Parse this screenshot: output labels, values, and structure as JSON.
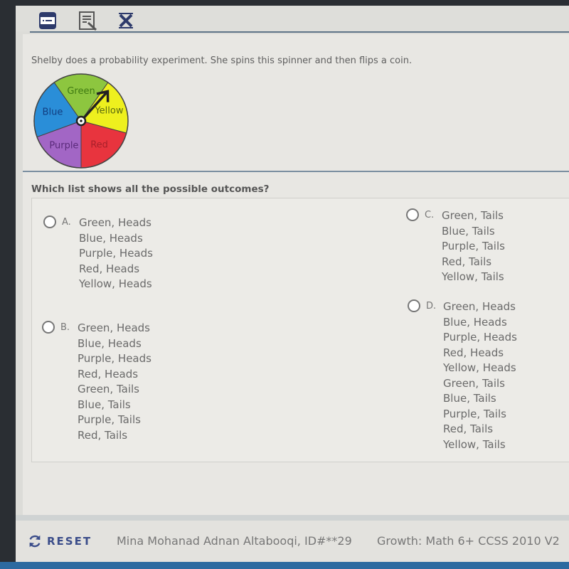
{
  "toolbar": {
    "icons": [
      "line-reader-icon",
      "notepad-icon",
      "answer-eliminator-icon"
    ]
  },
  "question": {
    "prompt": "Shelby does a probability experiment. She spins this spinner and then flips a coin.",
    "stem": "Which list shows all the possible outcomes?"
  },
  "spinner": {
    "sections": [
      {
        "label": "Green",
        "color": "#8dc63f"
      },
      {
        "label": "Yellow",
        "color": "#eef01e"
      },
      {
        "label": "Red",
        "color": "#e8343e"
      },
      {
        "label": "Purple",
        "color": "#a266c5"
      },
      {
        "label": "Blue",
        "color": "#2a8ed8"
      }
    ],
    "arrow_points_to": "Yellow"
  },
  "options": [
    {
      "letter": "A.",
      "outcomes": [
        "Green, Heads",
        "Blue, Heads",
        "Purple, Heads",
        "Red, Heads",
        "Yellow, Heads"
      ],
      "selected": false
    },
    {
      "letter": "B.",
      "outcomes": [
        "Green, Heads",
        "Blue, Heads",
        "Purple, Heads",
        "Red, Heads",
        "Green, Tails",
        "Blue, Tails",
        "Purple, Tails",
        "Red, Tails"
      ],
      "selected": false
    },
    {
      "letter": "C.",
      "outcomes": [
        "Green, Tails",
        "Blue, Tails",
        "Purple, Tails",
        "Red, Tails",
        "Yellow, Tails"
      ],
      "selected": false
    },
    {
      "letter": "D.",
      "outcomes": [
        "Green, Heads",
        "Blue, Heads",
        "Purple, Heads",
        "Red, Heads",
        "Yellow, Heads",
        "Green, Tails",
        "Blue, Tails",
        "Purple, Tails",
        "Red, Tails",
        "Yellow, Tails"
      ],
      "selected": false
    }
  ],
  "footer": {
    "reset_label": "RESET",
    "student": "Mina Mohanad Adnan Altabooqi, ID#**29",
    "test_name": "Growth: Math 6+ CCSS 2010 V2"
  },
  "colors": {
    "accent": "#3b4d8a",
    "divider": "#5f7488"
  }
}
